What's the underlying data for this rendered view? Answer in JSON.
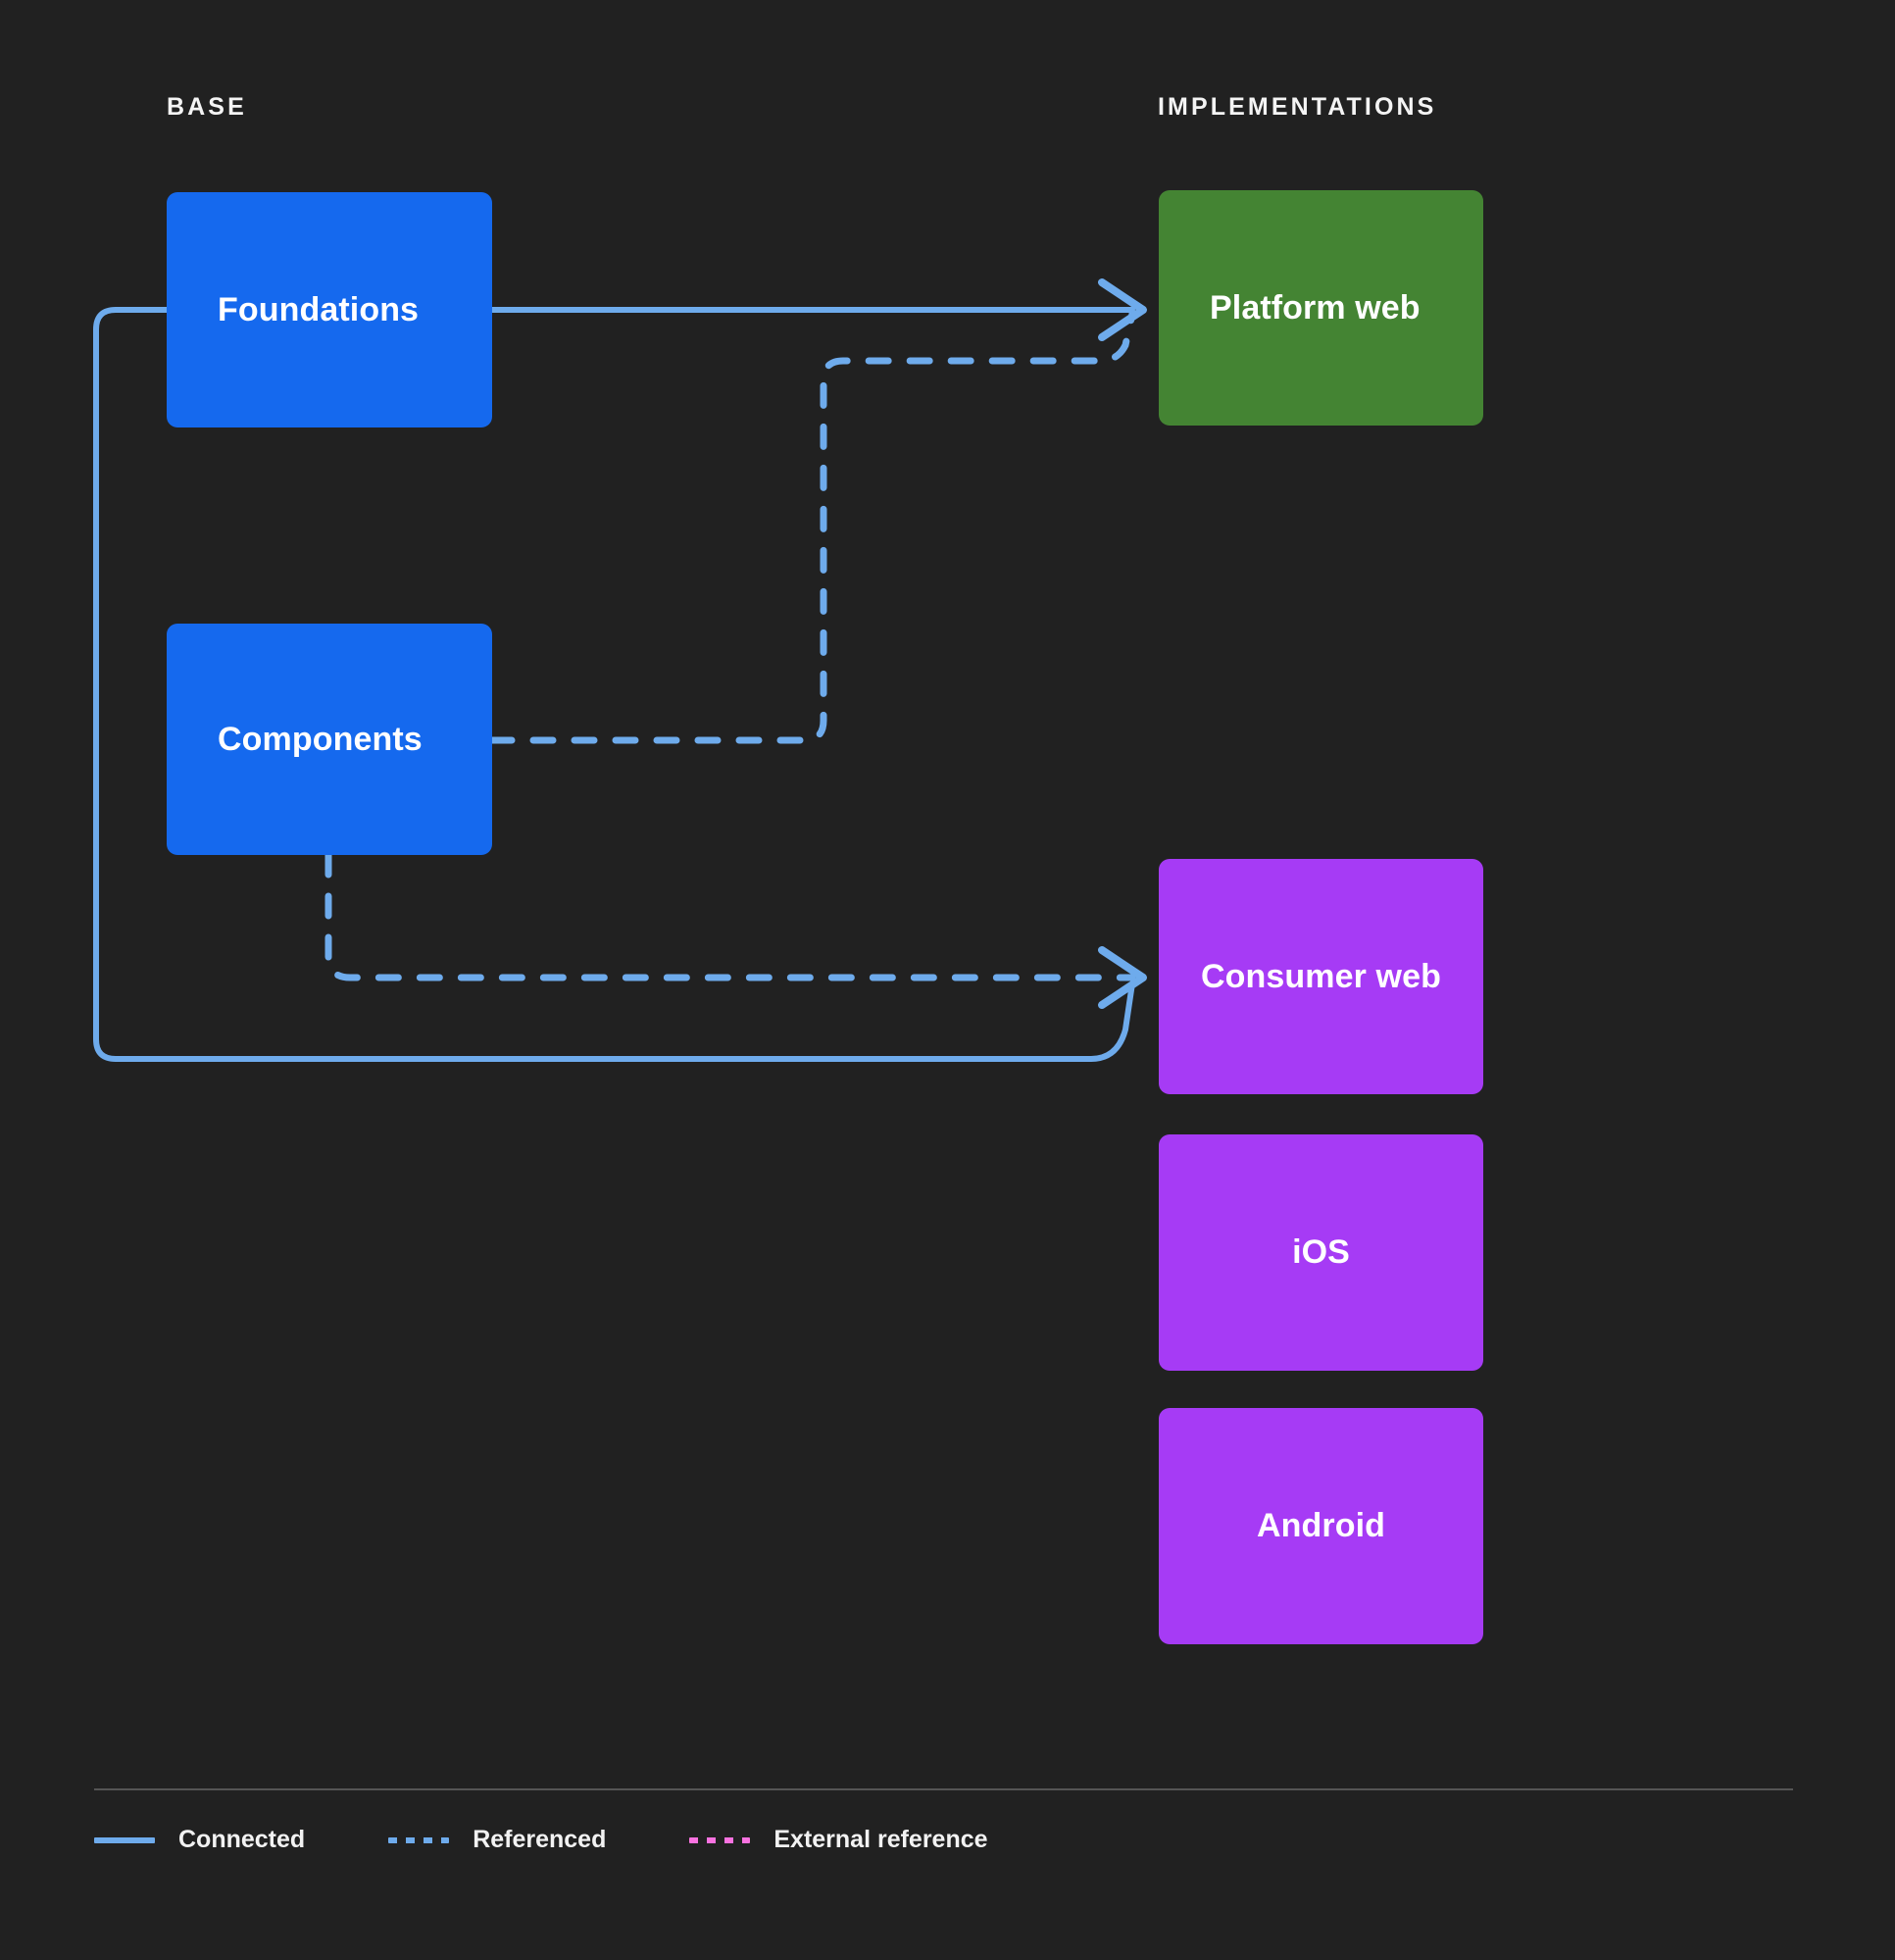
{
  "diagram": {
    "background_color": "#212121",
    "columns": [
      {
        "id": "base",
        "label": "BASE"
      },
      {
        "id": "implementations",
        "label": "IMPLEMENTATIONS"
      }
    ],
    "nodes": [
      {
        "id": "foundations",
        "label": "Foundations",
        "column": "base",
        "color": "#1569ee"
      },
      {
        "id": "components",
        "label": "Components",
        "column": "base",
        "color": "#1569ee"
      },
      {
        "id": "platform_web",
        "label": "Platform web",
        "column": "implementations",
        "color": "#448433"
      },
      {
        "id": "consumer_web",
        "label": "Consumer web",
        "column": "implementations",
        "color": "#a63bf5"
      },
      {
        "id": "ios",
        "label": "iOS",
        "column": "implementations",
        "color": "#a63bf5"
      },
      {
        "id": "android",
        "label": "Android",
        "column": "implementations",
        "color": "#a63bf5"
      }
    ],
    "edges": [
      {
        "from": "foundations",
        "to": "platform_web",
        "style": "connected",
        "arrow": true
      },
      {
        "from": "foundations",
        "to": "consumer_web",
        "style": "connected",
        "arrow": true
      },
      {
        "from": "components",
        "to": "platform_web",
        "style": "referenced",
        "arrow": true
      },
      {
        "from": "components",
        "to": "consumer_web",
        "style": "referenced",
        "arrow": true
      }
    ],
    "edge_color": "#6eabec"
  },
  "legend": {
    "items": [
      {
        "id": "connected",
        "label": "Connected",
        "style": "solid",
        "color": "#6eabec"
      },
      {
        "id": "referenced",
        "label": "Referenced",
        "style": "dashed",
        "color": "#6eabec"
      },
      {
        "id": "external_reference",
        "label": "External reference",
        "style": "dashed",
        "color": "#fa72e0"
      }
    ]
  }
}
